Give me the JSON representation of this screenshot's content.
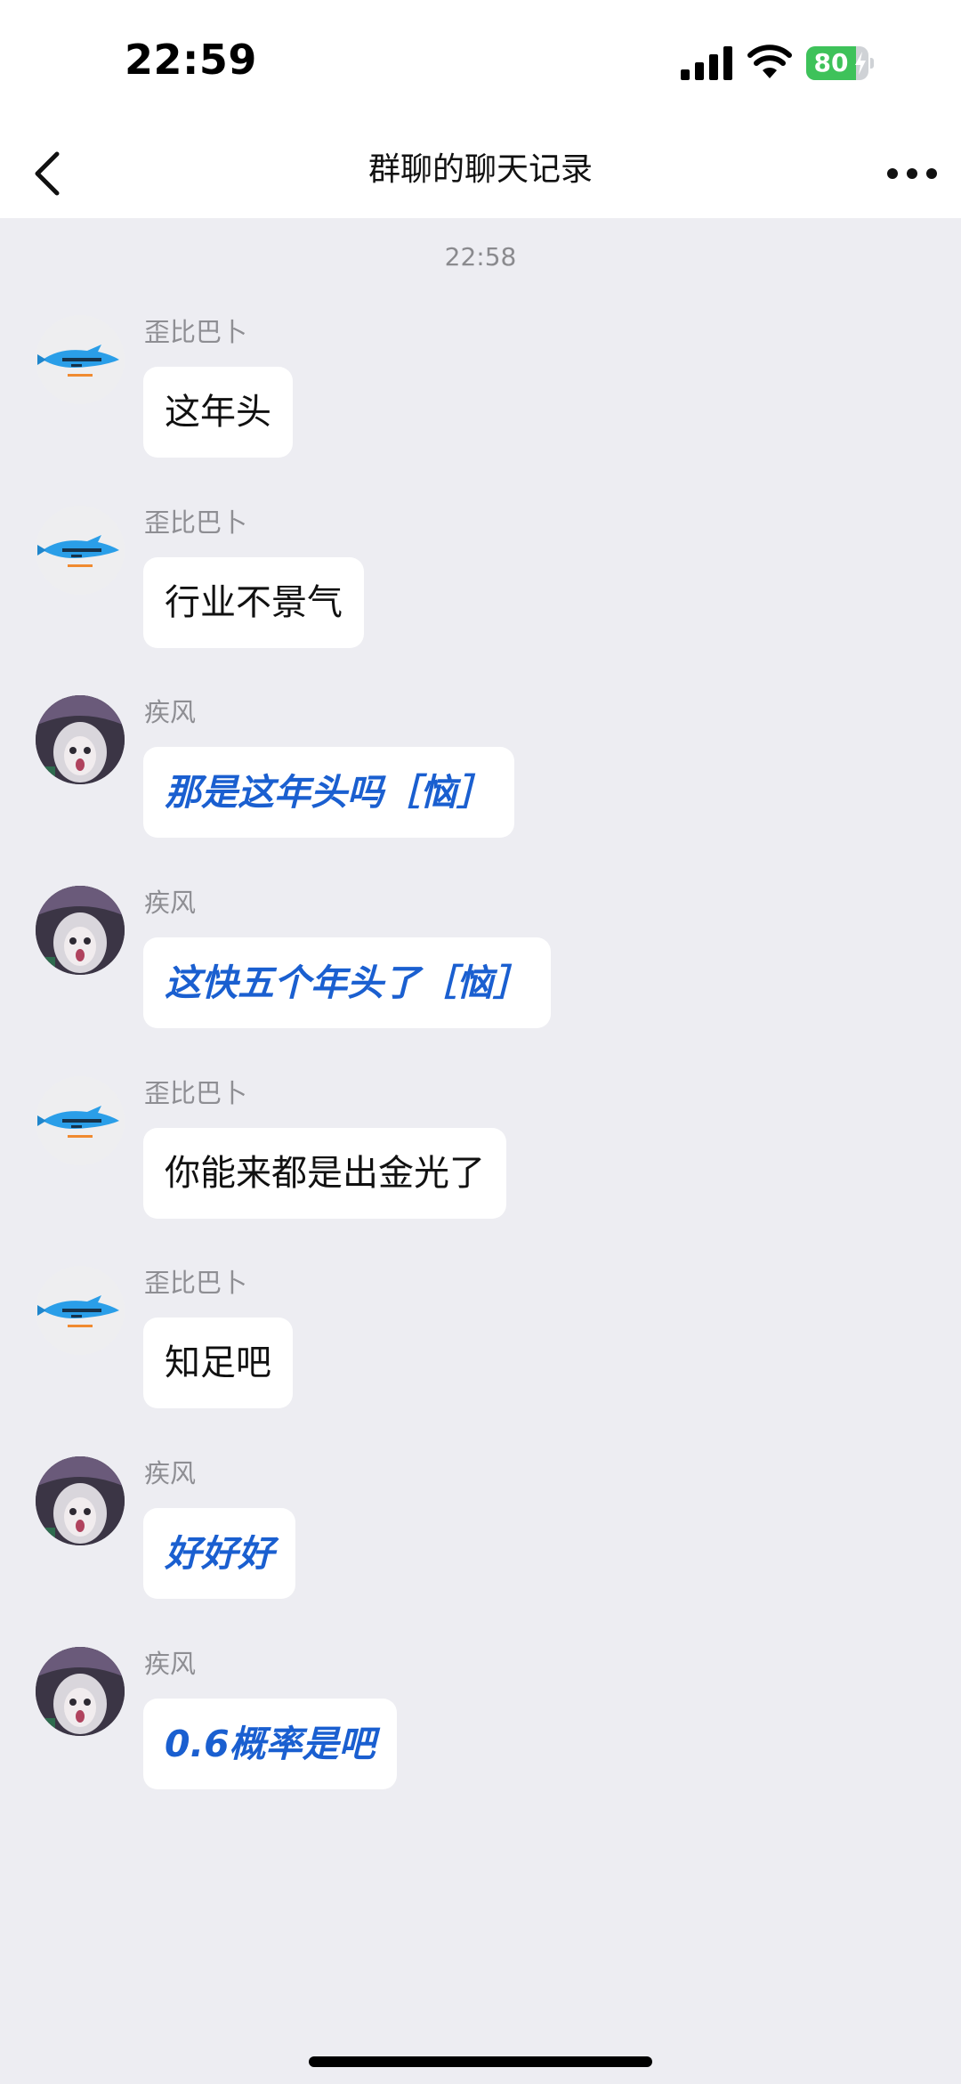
{
  "status_bar": {
    "time": "22:59",
    "battery_level": "80",
    "battery_fraction": 0.8,
    "signal_icon": "cellular-signal-icon",
    "wifi_icon": "wifi-icon",
    "charging_icon": "charging-bolt-icon",
    "battery_color": "#3ec25a"
  },
  "nav": {
    "title": "群聊的聊天记录",
    "back_icon": "chevron-left-icon",
    "more_icon": "more-dots-icon"
  },
  "chat": {
    "timestamp": "22:58",
    "messages": [
      {
        "sender": "歪比巴卜",
        "avatar": "fish-avatar",
        "text": "这年头",
        "style": "plain"
      },
      {
        "sender": "歪比巴卜",
        "avatar": "fish-avatar",
        "text": "行业不景气",
        "style": "plain"
      },
      {
        "sender": "疾风",
        "avatar": "girl-avatar",
        "text": "那是这年头吗［恼］",
        "style": "blue"
      },
      {
        "sender": "疾风",
        "avatar": "girl-avatar",
        "text": "这快五个年头了［恼］",
        "style": "blue"
      },
      {
        "sender": "歪比巴卜",
        "avatar": "fish-avatar",
        "text": "你能来都是出金光了",
        "style": "plain"
      },
      {
        "sender": "歪比巴卜",
        "avatar": "fish-avatar",
        "text": "知足吧",
        "style": "plain"
      },
      {
        "sender": "疾风",
        "avatar": "girl-avatar",
        "text": "好好好",
        "style": "blue"
      },
      {
        "sender": "疾风",
        "avatar": "girl-avatar",
        "text": "0.6概率是吧",
        "style": "blue"
      }
    ]
  },
  "colors": {
    "background": "#ededf2",
    "bubble": "#ffffff",
    "blue_text": "#1a5fd0",
    "meta_text": "#8e8e93"
  }
}
